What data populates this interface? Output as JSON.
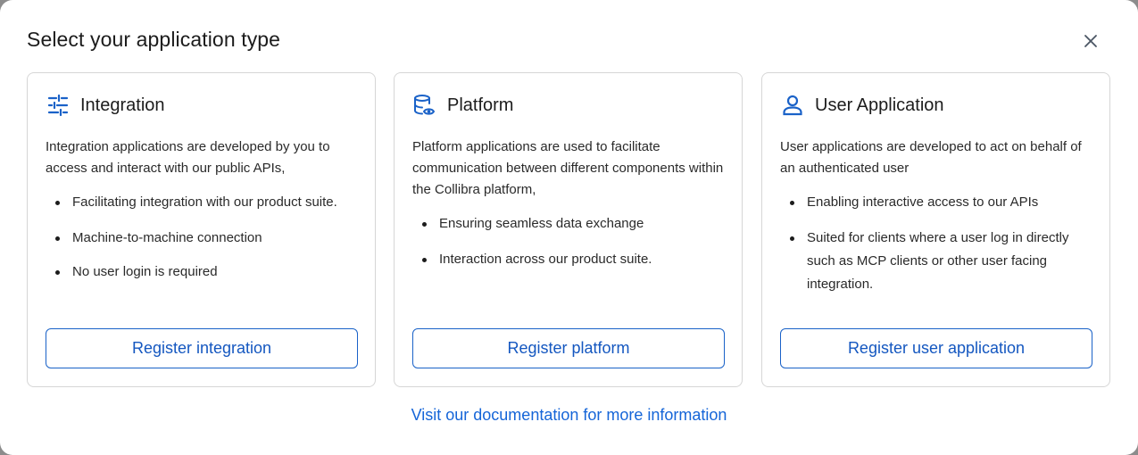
{
  "dialog": {
    "title": "Select your application type",
    "close_icon": "close-icon",
    "doc_link": "Visit our documentation for more information"
  },
  "cards": [
    {
      "icon": "sliders-icon",
      "title": "Integration",
      "description": "Integration applications are developed by you to access and interact with our public APIs,",
      "bullets": [
        "Facilitating integration with our product suite.",
        "Machine-to-machine connection",
        "No user login is required"
      ],
      "button": "Register integration"
    },
    {
      "icon": "database-eye-icon",
      "title": "Platform",
      "description": "Platform applications are used to facilitate communication between different components within the Collibra platform,",
      "bullets": [
        "Ensuring seamless data exchange",
        "Interaction across our product suite."
      ],
      "button": "Register platform"
    },
    {
      "icon": "user-icon",
      "title": "User Application",
      "description": "User applications are developed to act on behalf of an authenticated user",
      "bullets": [
        "Enabling interactive access to our APIs",
        "Suited for clients where a user log in directly such as MCP clients or other user facing integration."
      ],
      "button": "Register user application"
    }
  ],
  "colors": {
    "accent": "#1457c0",
    "border": "#d6d6d6",
    "text": "#1c1c1c"
  }
}
